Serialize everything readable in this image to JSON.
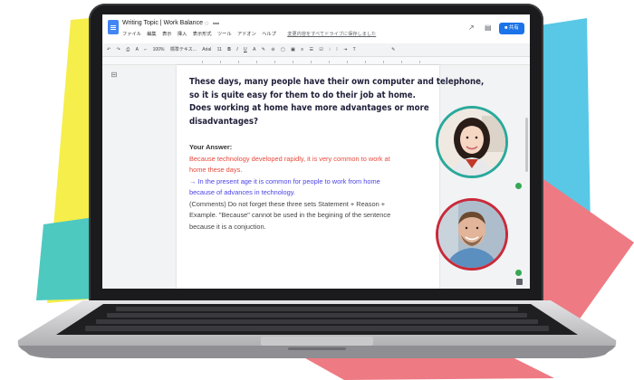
{
  "doc": {
    "title": "Writing Topic | Work Balance",
    "menu": [
      "ファイル",
      "編集",
      "表示",
      "挿入",
      "表示形式",
      "ツール",
      "アドオン",
      "ヘルプ"
    ],
    "save_status": "変更内容をすべてドライブに保存しました",
    "share_label": "共有"
  },
  "toolbar": {
    "zoom": "100%",
    "style": "標準テキス...",
    "font": "Arial",
    "font_size": "11"
  },
  "content": {
    "heading": [
      "These days, many people have their own computer and telephone,",
      "so it is quite easy for them to do their job at home.",
      "Does working at home have more advantages or more",
      "disadvantages?"
    ],
    "answer_label": "Your Answer:",
    "answer_red": [
      "Because technology developed rapidly, it is very common to work at",
      "home these days."
    ],
    "answer_blue": [
      "→ In the present age it is common for people to work from home",
      "because of advances in technology."
    ],
    "comments": [
      "(Comments) Do not forget these three sets Statement + Reason +",
      "Example. \"Because\" cannot be used in the begining of the sentence",
      "because it is a conjuction."
    ]
  },
  "colors": {
    "yellow": "#f6ee4a",
    "teal": "#4ec9c0",
    "cyan": "#58c8e6",
    "pink": "#ee7a83",
    "docs_blue": "#1a73e8",
    "red_text": "#e84a3c",
    "blue_text": "#4a44e6",
    "ring_teal": "#2aa99c",
    "ring_red": "#c92a3a"
  },
  "icons": [
    "docs-icon",
    "star-icon",
    "folder-icon",
    "trend-icon",
    "comment-icon",
    "lock-icon",
    "undo-icon",
    "redo-icon",
    "print-icon",
    "spellcheck-icon",
    "paint-format-icon",
    "bold-icon",
    "italic-icon",
    "underline-icon",
    "link-icon",
    "image-icon",
    "align-icon",
    "list-icon",
    "pencil-icon",
    "outline-icon"
  ]
}
